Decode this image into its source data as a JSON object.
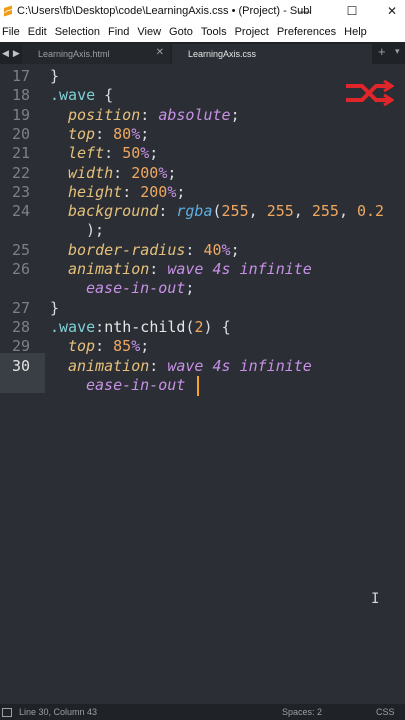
{
  "window": {
    "title": "C:\\Users\\fb\\Desktop\\code\\LearningAxis.css • (Project) - Subl...",
    "minimize_glyph": "—",
    "maximize_glyph": "☐",
    "close_glyph": "✕",
    "app_icon": "sublime-text-icon"
  },
  "menu": {
    "items": [
      "File",
      "Edit",
      "Selection",
      "Find",
      "View",
      "Goto",
      "Tools",
      "Project",
      "Preferences",
      "Help"
    ]
  },
  "tabs": {
    "nav_glyphs": [
      "◀",
      "▶"
    ],
    "items": [
      {
        "label": "LearningAxis.html",
        "active": false,
        "close_glyph": "✕"
      },
      {
        "label": "LearningAxis.css",
        "active": true,
        "close_glyph": ""
      }
    ],
    "add_glyph": "+",
    "more_glyph": "▾"
  },
  "editor": {
    "current_line": 30,
    "line_numbers": [
      "17",
      "18",
      "19",
      "20",
      "21",
      "22",
      "23",
      "24",
      "25",
      "26",
      "27",
      "28",
      "29",
      "30"
    ],
    "colors": {
      "background": "#2b2f35",
      "selector": "#7fcfd6",
      "property": "#e5c07b",
      "value": "#c791e6",
      "number": "#f0a860",
      "function": "#61afe0",
      "cursor": "#f5a623"
    }
  },
  "statusbar": {
    "position": "Line 30, Column 43",
    "indent": "Spaces: 2",
    "syntax": "CSS"
  },
  "overlay": {
    "logo_icon": "red-crossed-arrows-logo",
    "mouse_icon": "text-cursor-icon"
  }
}
